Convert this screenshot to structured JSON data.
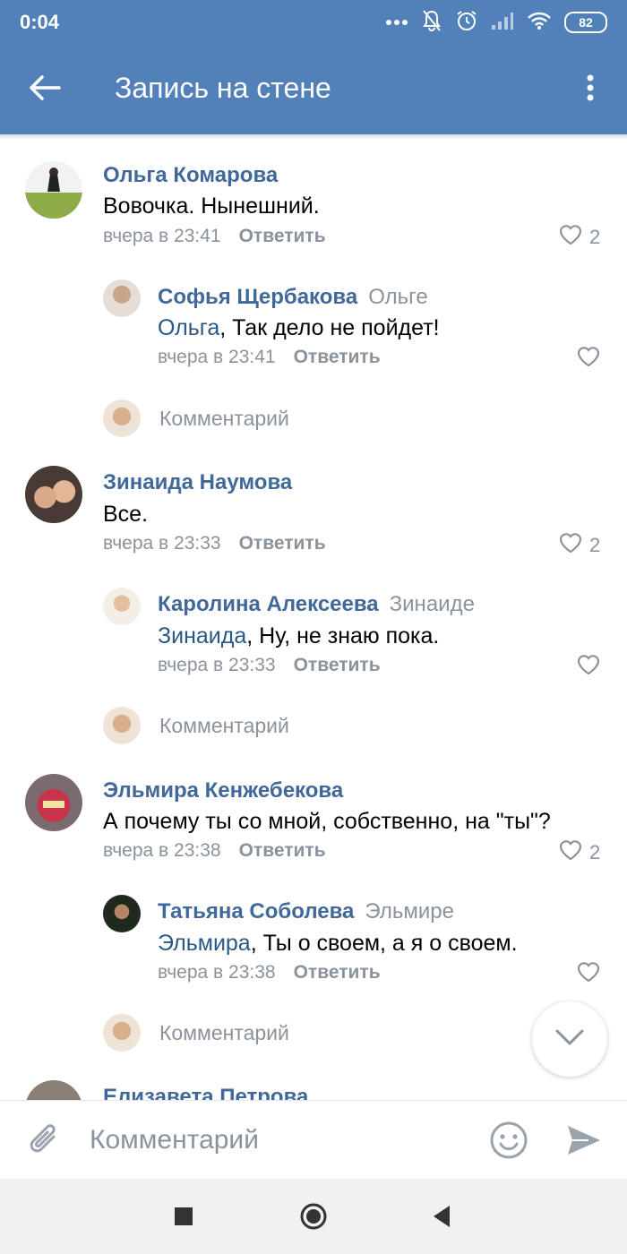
{
  "status_bar": {
    "time": "0:04",
    "battery": "82"
  },
  "toolbar": {
    "title": "Запись на стене"
  },
  "comment_placeholder": "Комментарий",
  "comments": [
    {
      "author": "Ольга Комарова",
      "text": "Вовочка. Нынешний.",
      "time": "вчера в 23:41",
      "reply_label": "Ответить",
      "likes": "2",
      "replies": [
        {
          "author": "Софья Щербакова",
          "reply_to": "Ольге",
          "mention": "Ольга",
          "text": ", Так дело не пойдет!",
          "time": "вчера в 23:41",
          "reply_label": "Ответить"
        }
      ]
    },
    {
      "author": "Зинаида Наумова",
      "text": "Все.",
      "time": "вчера в 23:33",
      "reply_label": "Ответить",
      "likes": "2",
      "replies": [
        {
          "author": "Каролина Алексеева",
          "reply_to": "Зинаиде",
          "mention": "Зинаида",
          "text": ", Ну, не знаю пока.",
          "time": "вчера в 23:33",
          "reply_label": "Ответить"
        }
      ]
    },
    {
      "author": "Эльмира Кенжебекова",
      "text": "А почему ты со мной, собственно, на \"ты\"?",
      "time": "вчера в 23:38",
      "reply_label": "Ответить",
      "likes": "2",
      "replies": [
        {
          "author": "Татьяна Соболева",
          "reply_to": "Эльмире",
          "mention": "Эльмира",
          "text": ", Ты о своем, а я о своем.",
          "time": "вчера в 23:38",
          "reply_label": "Ответить"
        }
      ]
    },
    {
      "author": "Елизавета Петрова"
    }
  ],
  "input": {
    "placeholder": "Комментарий"
  },
  "colors": {
    "header": "#5181b8",
    "author": "#41689b",
    "mention": "#2a5885",
    "secondary": "#8a929c"
  }
}
